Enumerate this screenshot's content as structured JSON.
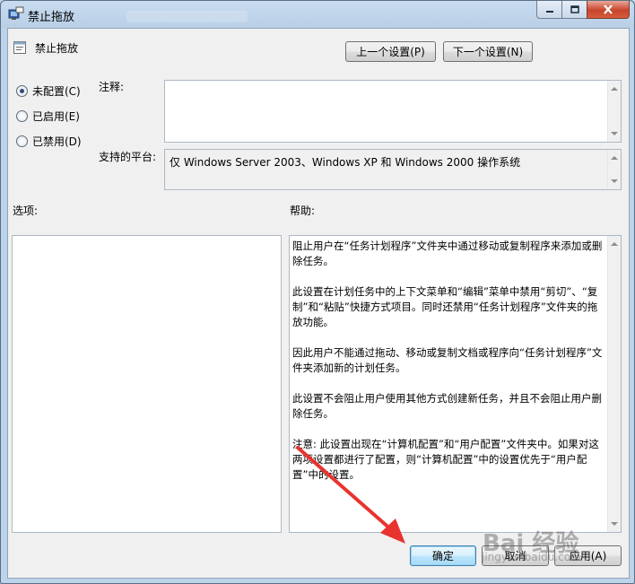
{
  "window": {
    "title": "禁止拖放"
  },
  "policy": {
    "name": "禁止拖放"
  },
  "nav": {
    "prev_label": "上一个设置(P)",
    "next_label": "下一个设置(N)"
  },
  "state_options": [
    {
      "label": "未配置(C)",
      "selected": true
    },
    {
      "label": "已启用(E)",
      "selected": false
    },
    {
      "label": "已禁用(D)",
      "selected": false
    }
  ],
  "comment": {
    "label": "注释:",
    "value": ""
  },
  "platform": {
    "label": "支持的平台:",
    "value": "仅 Windows Server 2003、Windows XP 和 Windows 2000 操作系统"
  },
  "options": {
    "label": "选项:"
  },
  "help": {
    "label": "帮助:",
    "paragraphs": [
      "阻止用户在“任务计划程序”文件夹中通过移动或复制程序来添加或删除任务。",
      "此设置在计划任务中的上下文菜单和“编辑”菜单中禁用“剪切”、“复制”和“粘贴”快捷方式项目。同时还禁用“任务计划程序”文件夹的拖放功能。",
      "因此用户不能通过拖动、移动或复制文档或程序向“任务计划程序”文件夹添加新的计划任务。",
      "此设置不会阻止用户使用其他方式创建新任务，并且不会阻止用户删除任务。",
      "注意: 此设置出现在“计算机配置”和“用户配置”文件夹中。如果对这两项设置都进行了配置，则“计算机配置”中的设置优先于“用户配置”中的设置。"
    ]
  },
  "buttons": {
    "ok": "确定",
    "cancel": "取消",
    "apply": "应用(A)"
  },
  "overlay": {
    "watermark_logo": "Bai 经验",
    "watermark_url": "jingyan.baidu.com",
    "arrow_color": "#e8332f"
  },
  "icons": {
    "app": "group-policy-icon",
    "policy": "setting-icon",
    "minimize": "minimize-icon",
    "maximize": "maximize-icon",
    "close": "close-icon"
  }
}
